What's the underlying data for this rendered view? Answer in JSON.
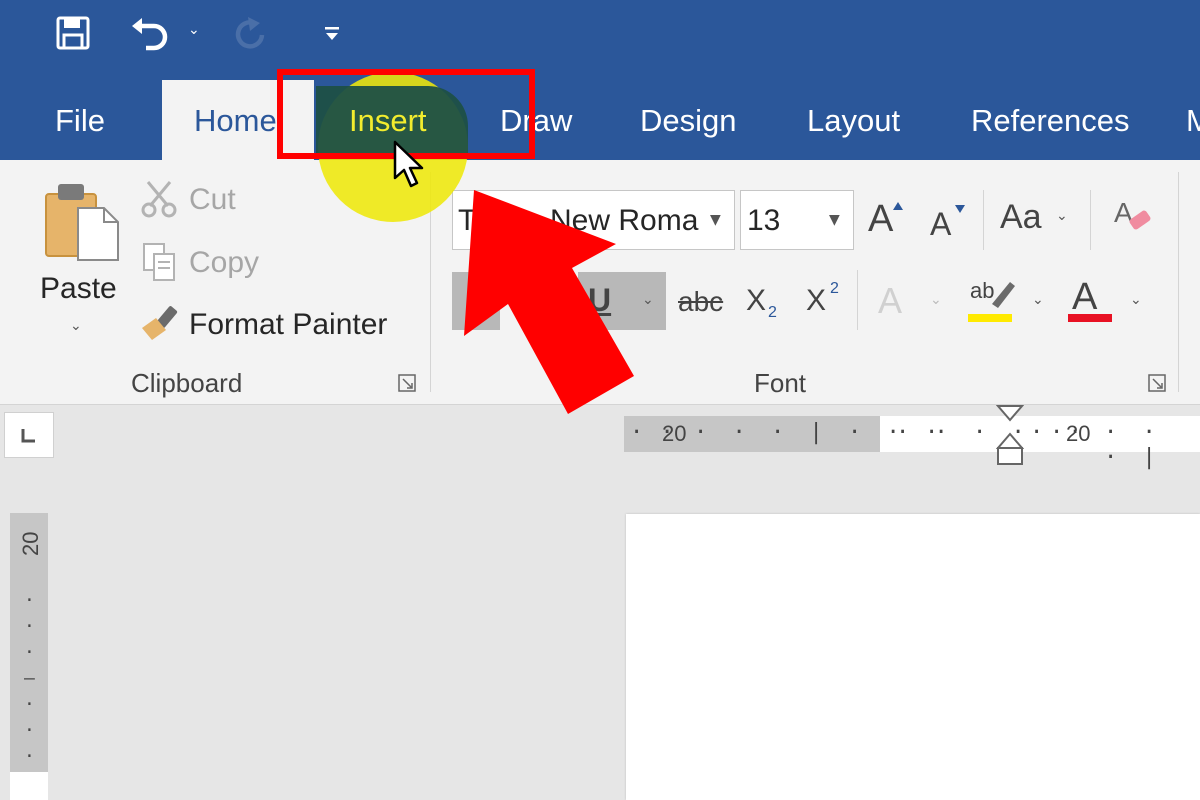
{
  "qat": {
    "save_icon": "save-icon",
    "undo_icon": "undo-icon",
    "redo_icon": "redo-icon",
    "customize_icon": "customize-qat-icon"
  },
  "tabs": {
    "file": "File",
    "home": "Home",
    "insert": "Insert",
    "draw": "Draw",
    "design": "Design",
    "layout": "Layout",
    "references": "References",
    "cut_off": "M"
  },
  "clipboard": {
    "paste": "Paste",
    "cut": "Cut",
    "copy": "Copy",
    "format_painter": "Format Painter",
    "group_label": "Clipboard"
  },
  "font": {
    "font_name": "Times New Roman",
    "font_name_visible_left": "Ti",
    "font_name_visible_right": "New Roma",
    "font_size": "13",
    "change_case": "Aa",
    "underline": "U",
    "strikethrough": "abc",
    "subscript_base": "X",
    "subscript_mark": "2",
    "superscript_base": "X",
    "superscript_mark": "2",
    "text_effects": "A",
    "highlight_glyph": "ab",
    "font_color_glyph": "A",
    "grow_font": "A",
    "shrink_font": "A",
    "group_label": "Font"
  },
  "ruler": {
    "left_label": "20",
    "right_label": "20",
    "vertical_label": "20"
  },
  "colors": {
    "title_bar": "#2b579a",
    "ribbon": "#f3f3f3",
    "highlight_yellow": "#ffea00",
    "font_color_red": "#e81123",
    "annotation_red": "#ff0000"
  }
}
